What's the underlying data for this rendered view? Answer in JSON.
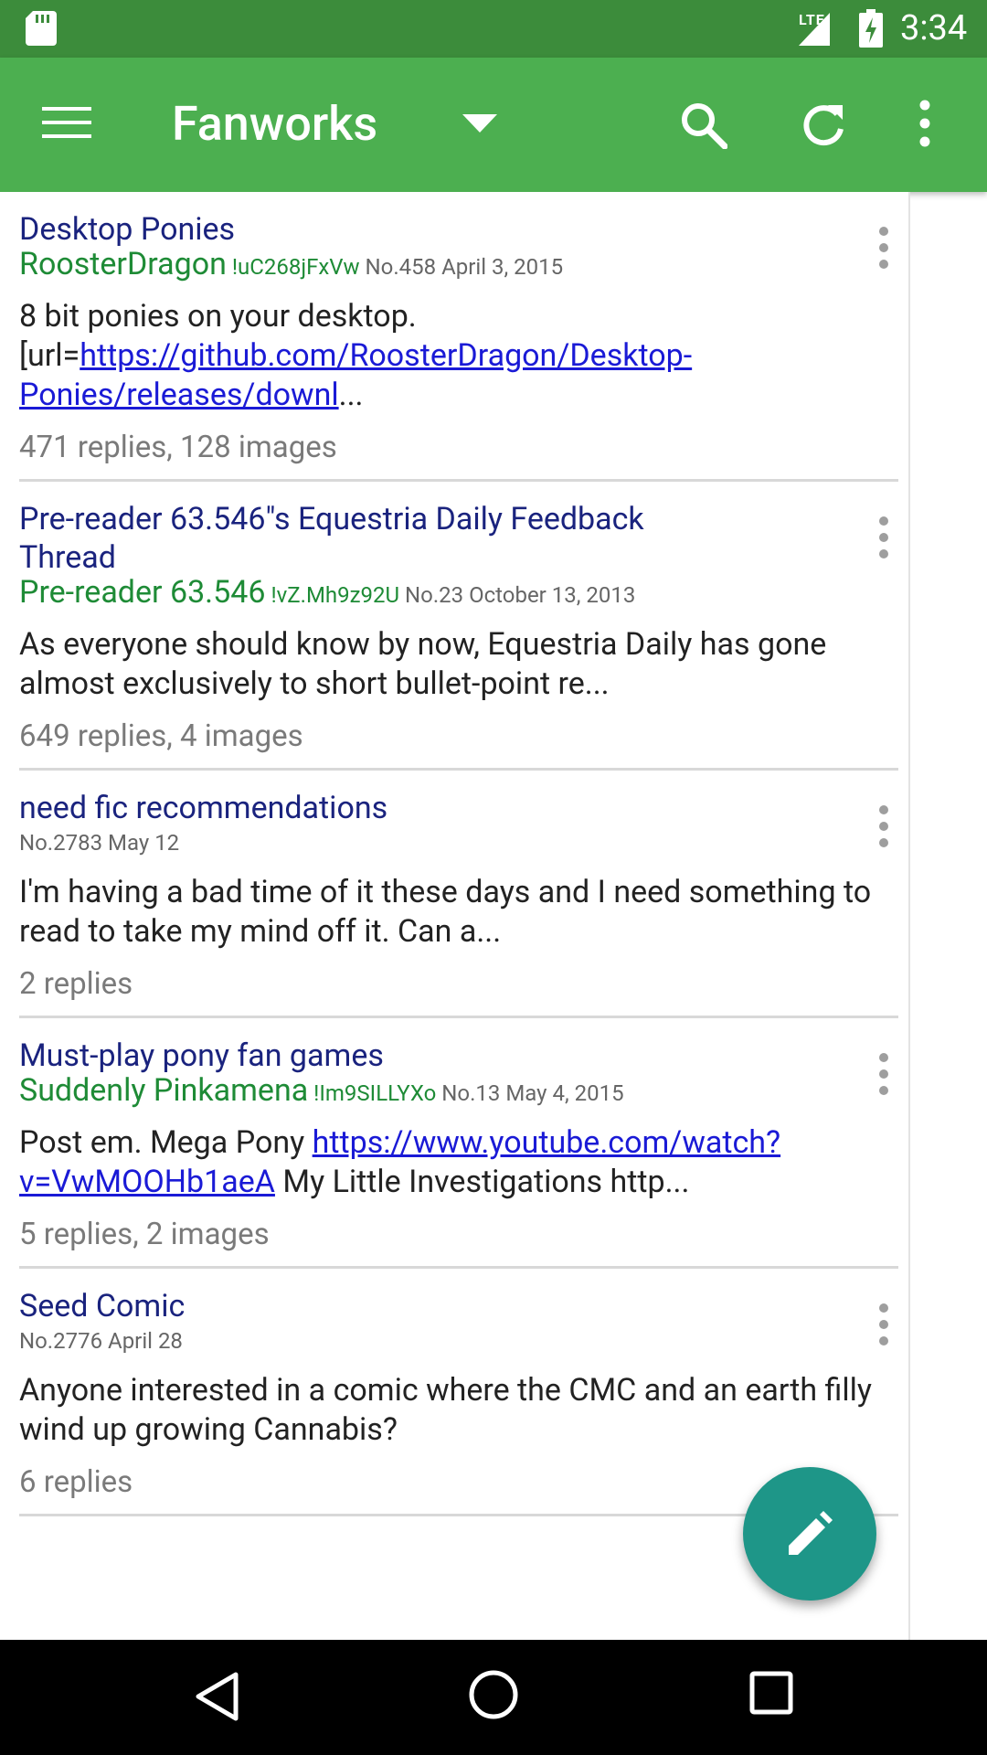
{
  "status_bar": {
    "network": "LTE",
    "time": "3:34"
  },
  "app_bar": {
    "title": "Fanworks"
  },
  "threads": [
    {
      "title": "Desktop Ponies",
      "author": "RoosterDragon",
      "trip": "!uC268jFxVw",
      "number": "No.458",
      "date": "April 3, 2015",
      "body_pre": "8 bit ponies on your desktop. [url=",
      "link": "https://github.com/RoosterDragon/Desktop-Ponies/releases/downl",
      "body_post": "...",
      "stats": "471 replies, 128 images"
    },
    {
      "title": "Pre-reader 63.546\"s Equestria Daily Feedback Thread",
      "author": "Pre-reader 63.546",
      "trip": "!vZ.Mh9z92U",
      "number": "No.23",
      "date": "October 13, 2013",
      "body_pre": "As everyone should know by now, Equestria Daily has gone almost exclusively to short bullet-point re...",
      "stats": "649 replies, 4 images"
    },
    {
      "title": "need fic recommendations",
      "number": "No.2783",
      "date": "May 12",
      "body_pre": "I'm having a bad time of it these days and I need something to read to take my mind off it. Can a...",
      "stats": "2 replies"
    },
    {
      "title": "Must-play pony fan games",
      "author": "Suddenly Pinkamena",
      "trip": "!Im9SILLYXo",
      "number": "No.13",
      "date": "May 4, 2015",
      "body_pre": "Post em. Mega Pony ",
      "link": "https://www.youtube.com/watch?v=VwMOOHb1aeA",
      "body_post": " My Little Investigations http...",
      "stats": "5 replies, 2 images"
    },
    {
      "title": "Seed Comic",
      "number": "No.2776",
      "date": "April 28",
      "body_pre": "Anyone interested in a comic where the CMC and a",
      "body_hidden": "n earth",
      "body_post": " filly wind up growing Cannabis?",
      "stats": "6 replies"
    }
  ],
  "colors": {
    "status_bar": "#3c8c3b",
    "app_bar": "#4caf50",
    "fab": "#1e9688",
    "title_text": "#1a237e",
    "author_text": "#1e8b36"
  }
}
